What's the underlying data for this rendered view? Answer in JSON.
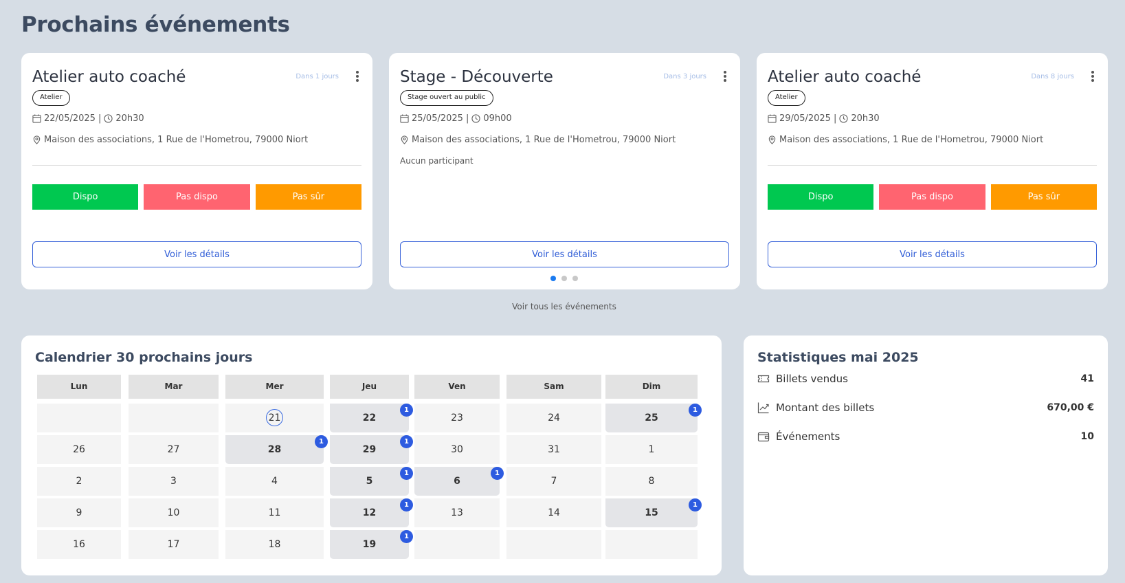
{
  "page": {
    "title": "Prochains événements",
    "see_all": "Voir tous les événements"
  },
  "events": [
    {
      "title": "Atelier auto coaché",
      "when": "Dans 1 jours",
      "badge": "Atelier",
      "date": "22/05/2025",
      "time": "20h30",
      "location": "Maison des associations, 1 Rue de l'Hometrou, 79000 Niort",
      "buttons": [
        "Dispo",
        "Pas dispo",
        "Pas sûr"
      ],
      "details": "Voir les détails"
    },
    {
      "title": "Stage - Découverte",
      "when": "Dans 3 jours",
      "badge": "Stage ouvert au public",
      "date": "25/05/2025",
      "time": "09h00",
      "location": "Maison des associations, 1 Rue de l'Hometrou, 79000 Niort",
      "participants": "Aucun participant",
      "details": "Voir les détails"
    },
    {
      "title": "Atelier auto coaché",
      "when": "Dans 8 jours",
      "badge": "Atelier",
      "date": "29/05/2025",
      "time": "20h30",
      "location": "Maison des associations, 1 Rue de l'Hometrou, 79000 Niort",
      "buttons": [
        "Dispo",
        "Pas dispo",
        "Pas sûr"
      ],
      "details": "Voir les détails"
    }
  ],
  "carousel": {
    "pages": 3,
    "active": 0
  },
  "calendar": {
    "title": "Calendrier 30 prochains jours",
    "days": [
      "Lun",
      "Mar",
      "Mer",
      "Jeu",
      "Ven",
      "Sam",
      "Dim"
    ],
    "weeks": [
      [
        {
          "d": ""
        },
        {
          "d": ""
        },
        {
          "d": "21",
          "today": true
        },
        {
          "d": "22",
          "count": "1"
        },
        {
          "d": "23"
        },
        {
          "d": "24"
        },
        {
          "d": "25",
          "count": "1"
        }
      ],
      [
        {
          "d": "26"
        },
        {
          "d": "27"
        },
        {
          "d": "28",
          "count": "1"
        },
        {
          "d": "29",
          "count": "1"
        },
        {
          "d": "30"
        },
        {
          "d": "31"
        },
        {
          "d": "1"
        }
      ],
      [
        {
          "d": "2"
        },
        {
          "d": "3"
        },
        {
          "d": "4"
        },
        {
          "d": "5",
          "count": "1"
        },
        {
          "d": "6",
          "count": "1"
        },
        {
          "d": "7"
        },
        {
          "d": "8"
        }
      ],
      [
        {
          "d": "9"
        },
        {
          "d": "10"
        },
        {
          "d": "11"
        },
        {
          "d": "12",
          "count": "1"
        },
        {
          "d": "13"
        },
        {
          "d": "14"
        },
        {
          "d": "15",
          "count": "1"
        }
      ],
      [
        {
          "d": "16"
        },
        {
          "d": "17"
        },
        {
          "d": "18"
        },
        {
          "d": "19",
          "count": "1"
        },
        {
          "d": ""
        },
        {
          "d": ""
        },
        {
          "d": ""
        }
      ]
    ]
  },
  "stats": {
    "title": "Statistiques mai 2025",
    "rows": [
      {
        "label": "Billets vendus",
        "value": "41",
        "icon": "ticket-icon"
      },
      {
        "label": "Montant des billets",
        "value": "670,00 €",
        "icon": "chart-line-icon"
      },
      {
        "label": "Événements",
        "value": "10",
        "icon": "wallet-icon"
      }
    ]
  }
}
